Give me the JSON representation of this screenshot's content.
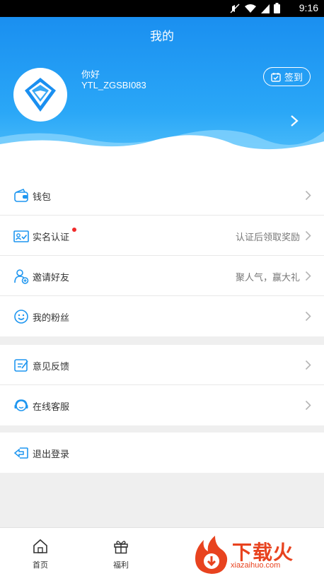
{
  "status_bar": {
    "time": "9:16"
  },
  "header": {
    "title": "我的",
    "greeting": "你好",
    "username": "YTL_ZGSBI083",
    "checkin_label": "签到"
  },
  "menu_group_1": [
    {
      "label": "钱包",
      "value": "",
      "icon": "wallet-icon"
    },
    {
      "label": "实名认证",
      "value": "认证后领取奖励",
      "icon": "id-card-icon"
    },
    {
      "label": "邀请好友",
      "value": "聚人气，赢大礼",
      "icon": "invite-user-icon"
    },
    {
      "label": "我的粉丝",
      "value": "",
      "icon": "smile-icon"
    }
  ],
  "menu_group_2": [
    {
      "label": "意见反馈",
      "icon": "feedback-icon"
    },
    {
      "label": "在线客服",
      "icon": "headset-icon"
    }
  ],
  "menu_group_3": [
    {
      "label": "退出登录",
      "icon": "logout-icon"
    }
  ],
  "tabs": [
    {
      "label": "首页",
      "icon": "home-icon"
    },
    {
      "label": "福利",
      "icon": "gift-icon"
    }
  ],
  "watermark": {
    "brand": "下载火",
    "url": "xiazaihuo.com"
  },
  "colors": {
    "primary": "#1e96f0",
    "accent_red": "#f02a2a",
    "watermark": "#e8431f"
  }
}
